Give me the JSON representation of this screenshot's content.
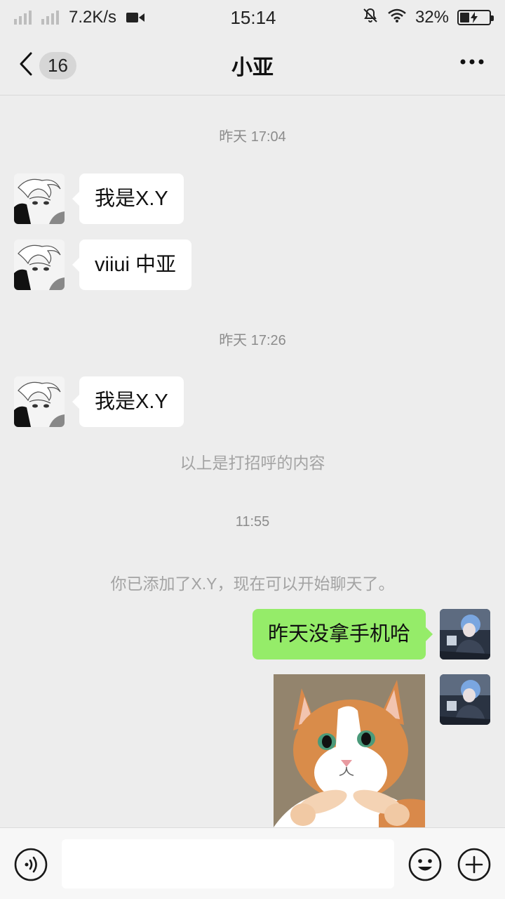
{
  "status_bar": {
    "net_speed": "7.2K/s",
    "time": "15:14",
    "battery_percent": "32%",
    "battery_level": 0.32,
    "icons": [
      "signal-icon",
      "signal-icon",
      "video-icon",
      "mute-bell-icon",
      "wifi-icon",
      "battery-charging-icon"
    ]
  },
  "nav": {
    "back_icon": "chevron-left-icon",
    "unread_count": "16",
    "title": "小亚",
    "more_icon": "more-dots-icon"
  },
  "chat": {
    "timestamps": [
      "昨天 17:04",
      "昨天 17:26",
      "11:55"
    ],
    "messages_incoming": [
      {
        "text": "我是X.Y"
      },
      {
        "text": "viiui 中亚"
      },
      {
        "text": "我是X.Y"
      }
    ],
    "system_greeting": "以上是打招呼的内容",
    "system_added": "你已添加了X.Y，现在可以开始聊天了。",
    "messages_outgoing": [
      {
        "text": "昨天没拿手机哈"
      }
    ],
    "sticker": "cat-sticker"
  },
  "input_bar": {
    "voice_icon": "voice-icon",
    "input_value": "",
    "emoji_icon": "emoji-icon",
    "plus_icon": "plus-icon"
  },
  "colors": {
    "background": "#ededed",
    "bubble_out": "#95ec69",
    "bubble_in": "#ffffff"
  }
}
